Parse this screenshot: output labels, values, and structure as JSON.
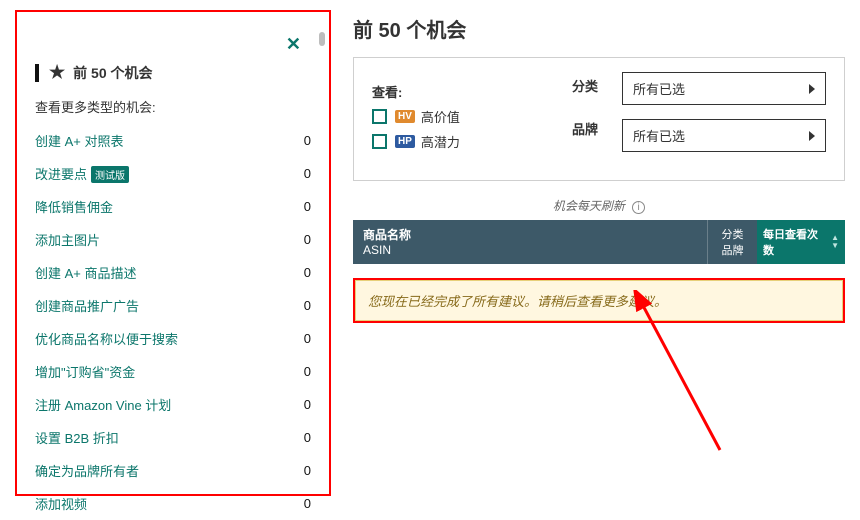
{
  "left": {
    "heading": "前 50 个机会",
    "sub": "查看更多类型的机会:",
    "items": [
      {
        "label": "创建 A+ 对照表",
        "count": "0"
      },
      {
        "label": "改进要点",
        "badge": "测试版",
        "count": "0"
      },
      {
        "label": "降低销售佣金",
        "count": "0"
      },
      {
        "label": "添加主图片",
        "count": "0"
      },
      {
        "label": "创建 A+ 商品描述",
        "count": "0"
      },
      {
        "label": "创建商品推广广告",
        "count": "0"
      },
      {
        "label": "优化商品名称以便于搜索",
        "count": "0"
      },
      {
        "label": "增加\"订购省\"资金",
        "count": "0"
      },
      {
        "label": "注册 Amazon Vine 计划",
        "count": "0"
      },
      {
        "label": "设置 B2B 折扣",
        "count": "0"
      },
      {
        "label": "确定为品牌所有者",
        "count": "0"
      },
      {
        "label": "添加视频",
        "count": "0"
      }
    ]
  },
  "right": {
    "title": "前 50 个机会",
    "look_label": "查看:",
    "hv_tag": "HV",
    "hv_label": "高价值",
    "hp_tag": "HP",
    "hp_label": "高潜力",
    "cat_label": "分类",
    "brand_label": "品牌",
    "sel1": "所有已选",
    "sel2": "所有已选",
    "refresh": "机会每天刷新",
    "header_name_l1": "商品名称",
    "header_name_l2": "ASIN",
    "header_cat_l1": "分类",
    "header_cat_l2": "品牌",
    "header_sort": "每日查看次数",
    "msg": "您现在已经完成了所有建议。请稍后查看更多建议。"
  }
}
